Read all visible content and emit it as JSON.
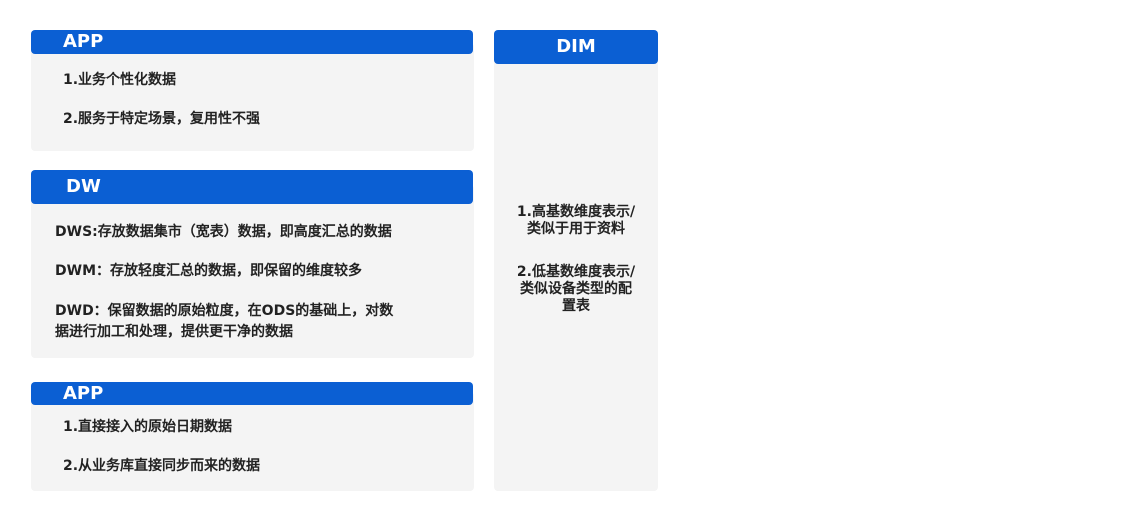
{
  "layers": {
    "app_top": {
      "title": "APP",
      "lines": [
        "1.业务个性化数据",
        "2.服务于特定场景，复用性不强"
      ]
    },
    "dw": {
      "title": "DW",
      "lines": [
        "DWS:存放数据集市（宽表）数据，即高度汇总的数据",
        "DWM：存放轻度汇总的数据，即保留的维度较多",
        "DWD：保留数据的原始粒度，在ODS的基础上，对数",
        "据进行加工和处理，提供更干净的数据"
      ]
    },
    "app_bottom": {
      "title": "APP",
      "lines": [
        "1.直接接入的原始日期数据",
        "2.从业务库直接同步而来的数据"
      ]
    },
    "dim": {
      "title": "DIM",
      "item1_lines": [
        "1.高基数维度表示/",
        "类似于用于资料"
      ],
      "item2_lines": [
        "2.低基数维度表示/",
        "类似设备类型的配",
        "置表"
      ]
    }
  },
  "colors": {
    "header": "#0b5fd3",
    "panel": "#f4f4f4"
  }
}
